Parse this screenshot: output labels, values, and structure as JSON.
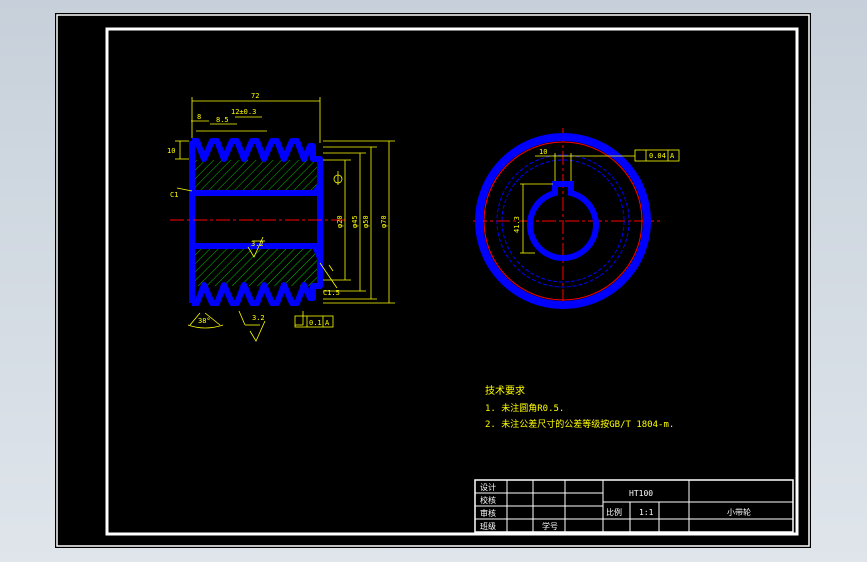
{
  "dims": {
    "overall_width": "72",
    "groove_pitch": "12±0.3",
    "groove_inner": "8.5",
    "groove_edge": "8",
    "groove_depth": "10",
    "bore_dia": "φ20",
    "hub_dia": "φ45",
    "pitch_dia": "φ50",
    "outer_dia": "φ70",
    "chamfer_left": "C1",
    "chamfer_right": "C1.5",
    "groove_angle": "38°",
    "roughness_bore": "3.2",
    "roughness_groove": "3.2",
    "runout_tol": "0.1",
    "runout_datum": "A",
    "keyway_width": "10",
    "keyway_depth": "41.3",
    "sym_tol": "0.04",
    "sym_datum": "A"
  },
  "notes": {
    "title": "技术要求",
    "line1": "1. 未注圆角R0.5.",
    "line2": "2. 未注公差尺寸的公差等级按GB/T 1804-m."
  },
  "title_block": {
    "designer_label": "设计",
    "checker_label": "校核",
    "reviewer_label": "审核",
    "class_label": "班级",
    "student_no_label": "学号",
    "material": "HT100",
    "scale_label": "比例",
    "scale_value": "1:1",
    "part_name": "小带轮"
  },
  "colors": {
    "outline": "#0000ff",
    "dimension": "#ffff00",
    "hatch": "#00c000",
    "centerline": "#ff0000",
    "frame": "#ffffff",
    "background": "#000000"
  }
}
